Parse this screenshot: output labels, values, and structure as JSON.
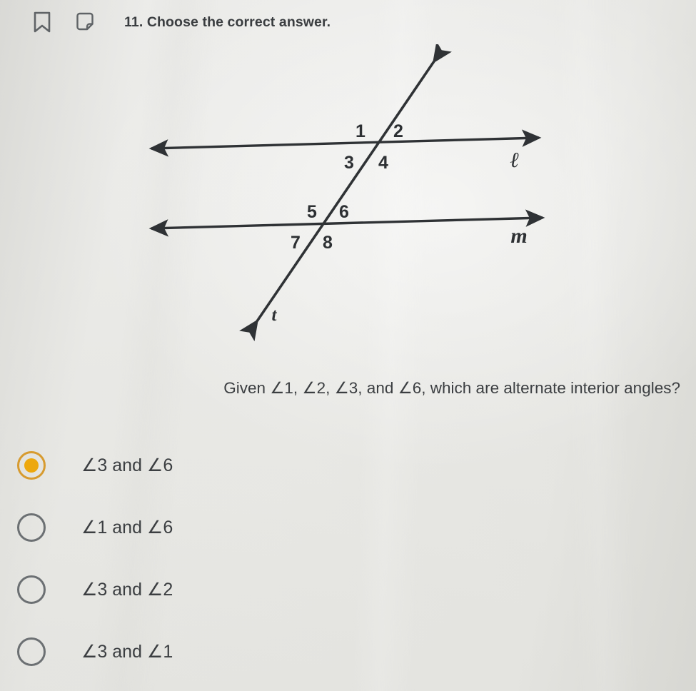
{
  "header": {
    "bookmark_icon": "bookmark-icon",
    "note_icon": "note-icon",
    "title": "11. Choose the correct answer."
  },
  "diagram": {
    "type": "parallel-lines-transversal",
    "line_labels": [
      {
        "id": "l",
        "text": "ℓ"
      },
      {
        "id": "m",
        "text": "m"
      },
      {
        "id": "t",
        "text": "t"
      }
    ],
    "angle_labels": [
      "1",
      "2",
      "3",
      "4",
      "5",
      "6",
      "7",
      "8"
    ],
    "description": "Two parallel lines l and m cut by transversal t, eight numbered angles"
  },
  "question": {
    "prefix": "Given ",
    "angles": "∠1, ∠2, ∠3,",
    "conjunction": "  and  ",
    "last_angle": "∠6",
    "suffix": ", which are alternate interior angles?",
    "full_text": "Given ∠1, ∠2, ∠3,  and  ∠6, which are alternate interior angles?"
  },
  "options": [
    {
      "label": "∠3 and ∠6",
      "selected": true
    },
    {
      "label": "∠1 and ∠6",
      "selected": false
    },
    {
      "label": "∠3 and ∠2",
      "selected": false
    },
    {
      "label": "∠3 and ∠1",
      "selected": false
    }
  ],
  "colors": {
    "background": "#e9e9e6",
    "text": "#3b3e41",
    "selected_ring": "#d79b30",
    "selected_dot": "#eda80e",
    "radio_outline": "#6c7073",
    "ink": "#2d3033"
  }
}
